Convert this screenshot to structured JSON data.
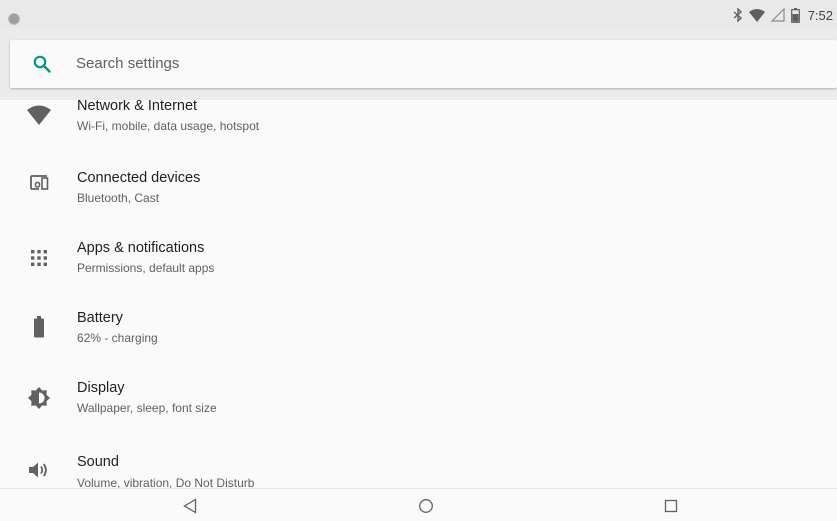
{
  "status_bar": {
    "time": "7:52",
    "icons": [
      "bluetooth-icon",
      "wifi-icon",
      "cellular-icon",
      "battery-icon"
    ]
  },
  "search": {
    "placeholder": "Search settings",
    "icon": "search-icon",
    "accent_color": "#009688"
  },
  "settings": {
    "items": [
      {
        "icon": "wifi-icon",
        "title": "Network & Internet",
        "subtitle": "Wi-Fi, mobile, data usage, hotspot"
      },
      {
        "icon": "devices-icon",
        "title": "Connected devices",
        "subtitle": "Bluetooth, Cast"
      },
      {
        "icon": "apps-icon",
        "title": "Apps & notifications",
        "subtitle": "Permissions, default apps"
      },
      {
        "icon": "battery-icon",
        "title": "Battery",
        "subtitle": "62% - charging"
      },
      {
        "icon": "brightness-icon",
        "title": "Display",
        "subtitle": "Wallpaper, sleep, font size"
      },
      {
        "icon": "volume-icon",
        "title": "Sound",
        "subtitle": "Volume, vibration, Do Not Disturb"
      }
    ]
  },
  "nav_bar": {
    "buttons": [
      "back-icon",
      "home-icon",
      "recents-icon"
    ]
  }
}
